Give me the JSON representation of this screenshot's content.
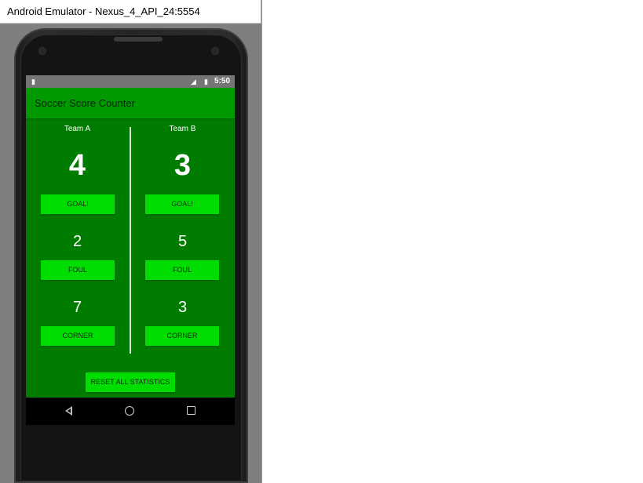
{
  "window": {
    "title": "Android Emulator - Nexus_4_API_24:5554"
  },
  "statusbar": {
    "time": "5:50",
    "icons": [
      "sd-card-icon",
      "signal-icon",
      "battery-icon"
    ]
  },
  "app": {
    "title": "Soccer Score Counter",
    "colors": {
      "background": "#007c00",
      "appbar": "#009900",
      "button": "#00dd00"
    }
  },
  "team_a": {
    "name": "Team A",
    "score": "4",
    "goal_label": "GOAL!",
    "fouls": "2",
    "foul_label": "FOUL",
    "corners": "7",
    "corner_label": "CORNER"
  },
  "team_b": {
    "name": "Team B",
    "score": "3",
    "goal_label": "GOAL!",
    "fouls": "5",
    "foul_label": "FOUL",
    "corners": "3",
    "corner_label": "CORNER"
  },
  "reset_label": "RESET ALL STATISTICS",
  "navbar": {
    "icons": [
      "back-icon",
      "home-icon",
      "recent-apps-icon"
    ]
  }
}
